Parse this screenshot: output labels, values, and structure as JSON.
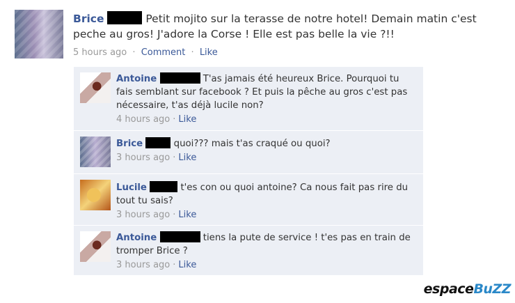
{
  "post": {
    "author": "Brice",
    "text": "Petit mojito sur la terasse de notre hotel! Demain matin c'est peche au gros! J'adore la Corse ! Elle est pas belle la vie ?!!",
    "time": "5 hours ago",
    "comment_label": "Comment",
    "like_label": "Like",
    "separator": "·"
  },
  "comments": [
    {
      "author": "Antoine",
      "text": "T'as jamais été heureux Brice. Pourquoi tu fais semblant sur facebook ? Et puis la pêche au gros c'est pas nécessaire, t'as déjà lucile non?",
      "time": "4 hours ago",
      "like_label": "Like"
    },
    {
      "author": "Brice",
      "text": "quoi??? mais t'as craqué ou quoi?",
      "time": "3 hours ago",
      "like_label": "Like"
    },
    {
      "author": "Lucile",
      "text": "t'es con ou quoi antoine? Ca nous fait pas rire du tout tu sais?",
      "time": "3 hours ago",
      "like_label": "Like"
    },
    {
      "author": "Antoine",
      "text": "tiens la pute de service ! t'es pas en train de tromper Brice ?",
      "time": "3 hours ago",
      "like_label": "Like"
    }
  ],
  "watermark": {
    "part1": "espace",
    "part2": "BuZZ"
  },
  "colors": {
    "link": "#3b5998",
    "comment_bg": "#eceff5",
    "meta": "#999999"
  }
}
